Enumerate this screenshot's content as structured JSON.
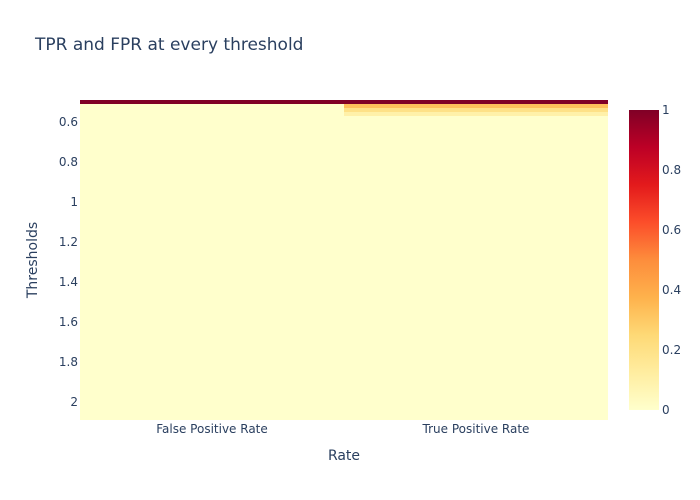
{
  "chart_data": {
    "type": "heatmap",
    "title": "TPR and FPR at every threshold",
    "xlabel": "Rate",
    "ylabel": "Thresholds",
    "x_categories": [
      "False Positive Rate",
      "True Positive Rate"
    ],
    "y_ticks": [
      "0.6",
      "0.8",
      "1",
      "1.2",
      "1.4",
      "1.6",
      "1.8",
      "2"
    ],
    "ylim": [
      2.09,
      0.49
    ],
    "rows": [
      {
        "threshold_range": [
          0.49,
          0.51
        ],
        "values": [
          1.0,
          1.0
        ]
      },
      {
        "threshold_range": [
          0.51,
          0.53
        ],
        "values": [
          0.0,
          0.33
        ]
      },
      {
        "threshold_range": [
          0.53,
          0.55
        ],
        "values": [
          0.0,
          0.2
        ]
      },
      {
        "threshold_range": [
          0.55,
          0.57
        ],
        "values": [
          0.0,
          0.1
        ]
      },
      {
        "threshold_range": [
          0.57,
          2.09
        ],
        "values": [
          0.0,
          0.0
        ]
      }
    ],
    "colorbar": {
      "range": [
        0,
        1
      ],
      "ticks": [
        "0",
        "0.2",
        "0.4",
        "0.6",
        "0.8",
        "1"
      ],
      "colorscale": [
        [
          0.0,
          "#ffffcc"
        ],
        [
          0.125,
          "#ffeda0"
        ],
        [
          0.25,
          "#fed976"
        ],
        [
          0.375,
          "#feb24c"
        ],
        [
          0.5,
          "#fd8d3c"
        ],
        [
          0.625,
          "#fc4e2a"
        ],
        [
          0.75,
          "#e31a1c"
        ],
        [
          0.875,
          "#bd0026"
        ],
        [
          1.0,
          "#800026"
        ]
      ]
    },
    "grid": false,
    "legend": "colorbar-right"
  }
}
